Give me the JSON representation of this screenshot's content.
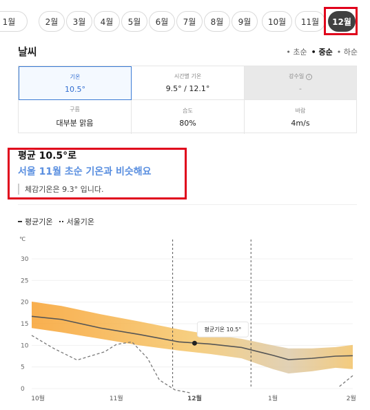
{
  "months": [
    "1월",
    "2월",
    "3월",
    "4월",
    "5월",
    "6월",
    "7월",
    "8월",
    "9월",
    "10월",
    "11월",
    "12월"
  ],
  "selected_month": "12월",
  "weather": {
    "title": "날씨",
    "period_tabs": [
      "초순",
      "중순",
      "하순"
    ],
    "selected_period": "중순",
    "cells": [
      {
        "label": "기온",
        "value": "10.5°"
      },
      {
        "label": "시간별 기온",
        "value": "9.5° / 12.1°"
      },
      {
        "label": "강수일",
        "value": "-"
      },
      {
        "label": "구름",
        "value": "대부분 맑음"
      },
      {
        "label": "습도",
        "value": "80%"
      },
      {
        "label": "바람",
        "value": "4m/s"
      }
    ]
  },
  "summary": {
    "title": "평균 10.5°로",
    "comparison": "서울 11월 초순 기온과 비슷해요",
    "feels_like": "체감기온은 9.3° 입니다."
  },
  "chart_legend": {
    "series_a": "평균기온",
    "series_b": "서울기온"
  },
  "colors": {
    "band_top": "#f7a533",
    "band_bottom": "#d5c3a8",
    "selected": "#3a7bd5",
    "highlight": "#e0001b",
    "accent_text": "#5a8fe0"
  },
  "chart_data": {
    "type": "line",
    "ylabel": "℃",
    "ylim": [
      0,
      30
    ],
    "yticks": [
      0,
      5,
      10,
      15,
      20,
      25,
      30
    ],
    "xticks": [
      {
        "label": "10월",
        "x": 0
      },
      {
        "label": "11월",
        "x": 1
      },
      {
        "label": "12월",
        "x": 2
      },
      {
        "label": "1월",
        "x": 3
      },
      {
        "label": "2월",
        "x": 4
      }
    ],
    "x_range": [
      -0.08,
      4.02
    ],
    "highlight_range": [
      1.72,
      2.72
    ],
    "tooltip": {
      "label": "평균기온 10.5°",
      "x": 2.0,
      "y": 10.5
    },
    "series": [
      {
        "name": "평균기온",
        "x": [
          -0.08,
          0.3,
          0.8,
          1.3,
          1.8,
          2.2,
          2.6,
          3.0,
          3.2,
          3.5,
          3.8,
          4.02
        ],
        "values": [
          16.7,
          16.0,
          14.0,
          12.5,
          10.8,
          10.3,
          9.5,
          7.7,
          6.7,
          7.0,
          7.5,
          7.6
        ]
      },
      {
        "name": "band_upper",
        "x": [
          -0.08,
          0.3,
          0.8,
          1.3,
          1.8,
          2.2,
          2.6,
          3.0,
          3.2,
          3.5,
          3.8,
          4.02
        ],
        "values": [
          20.1,
          19.1,
          17.2,
          15.5,
          13.7,
          12.5,
          11.5,
          10.0,
          9.3,
          9.3,
          9.6,
          10.1
        ]
      },
      {
        "name": "band_lower",
        "x": [
          -0.08,
          0.3,
          0.8,
          1.3,
          1.8,
          2.2,
          2.6,
          3.0,
          3.2,
          3.5,
          3.8,
          4.02
        ],
        "values": [
          14.0,
          13.0,
          11.5,
          10.0,
          8.8,
          8.0,
          7.0,
          4.5,
          3.5,
          4.0,
          4.8,
          4.5
        ]
      },
      {
        "name": "서울기온",
        "x": [
          -0.08,
          0.2,
          0.5,
          0.85,
          1.0,
          1.2,
          1.4,
          1.55,
          1.75,
          1.95
        ],
        "values": [
          12.3,
          9.3,
          6.6,
          8.5,
          10.2,
          10.8,
          7.0,
          2.0,
          -0.3,
          -1.0
        ]
      },
      {
        "name": "서울기온_tail",
        "x": [
          3.85,
          4.02
        ],
        "values": [
          0.5,
          3.0
        ]
      }
    ]
  }
}
